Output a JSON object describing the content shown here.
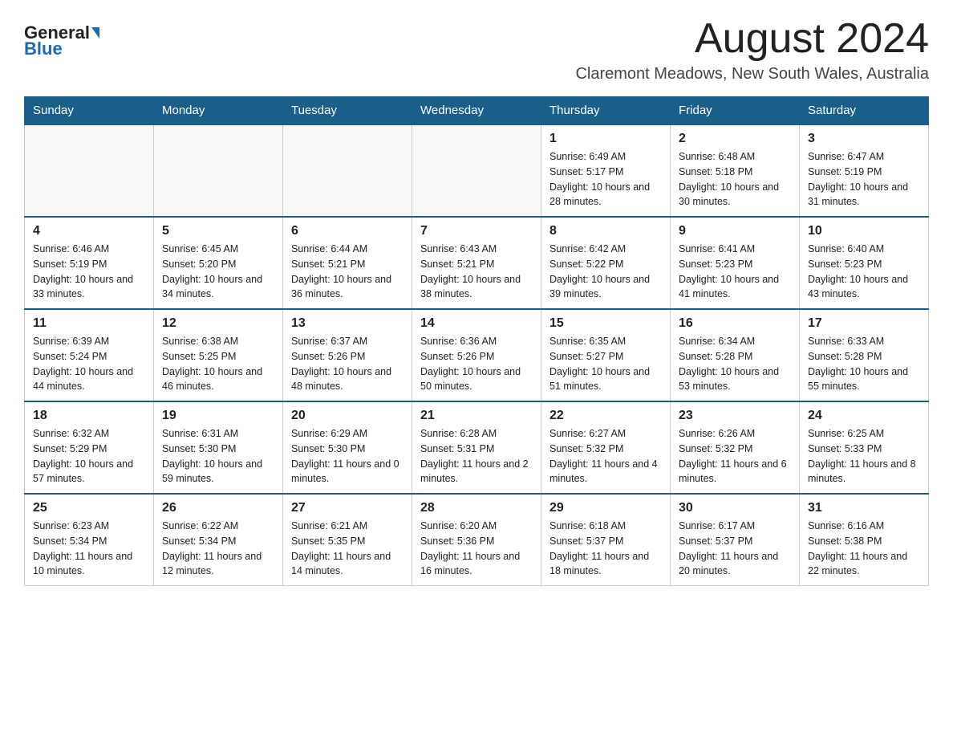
{
  "header": {
    "logo_general": "General",
    "logo_blue": "Blue",
    "month_title": "August 2024",
    "subtitle": "Claremont Meadows, New South Wales, Australia"
  },
  "days_of_week": [
    "Sunday",
    "Monday",
    "Tuesday",
    "Wednesday",
    "Thursday",
    "Friday",
    "Saturday"
  ],
  "weeks": [
    [
      {
        "num": "",
        "info": ""
      },
      {
        "num": "",
        "info": ""
      },
      {
        "num": "",
        "info": ""
      },
      {
        "num": "",
        "info": ""
      },
      {
        "num": "1",
        "info": "Sunrise: 6:49 AM\nSunset: 5:17 PM\nDaylight: 10 hours and 28 minutes."
      },
      {
        "num": "2",
        "info": "Sunrise: 6:48 AM\nSunset: 5:18 PM\nDaylight: 10 hours and 30 minutes."
      },
      {
        "num": "3",
        "info": "Sunrise: 6:47 AM\nSunset: 5:19 PM\nDaylight: 10 hours and 31 minutes."
      }
    ],
    [
      {
        "num": "4",
        "info": "Sunrise: 6:46 AM\nSunset: 5:19 PM\nDaylight: 10 hours and 33 minutes."
      },
      {
        "num": "5",
        "info": "Sunrise: 6:45 AM\nSunset: 5:20 PM\nDaylight: 10 hours and 34 minutes."
      },
      {
        "num": "6",
        "info": "Sunrise: 6:44 AM\nSunset: 5:21 PM\nDaylight: 10 hours and 36 minutes."
      },
      {
        "num": "7",
        "info": "Sunrise: 6:43 AM\nSunset: 5:21 PM\nDaylight: 10 hours and 38 minutes."
      },
      {
        "num": "8",
        "info": "Sunrise: 6:42 AM\nSunset: 5:22 PM\nDaylight: 10 hours and 39 minutes."
      },
      {
        "num": "9",
        "info": "Sunrise: 6:41 AM\nSunset: 5:23 PM\nDaylight: 10 hours and 41 minutes."
      },
      {
        "num": "10",
        "info": "Sunrise: 6:40 AM\nSunset: 5:23 PM\nDaylight: 10 hours and 43 minutes."
      }
    ],
    [
      {
        "num": "11",
        "info": "Sunrise: 6:39 AM\nSunset: 5:24 PM\nDaylight: 10 hours and 44 minutes."
      },
      {
        "num": "12",
        "info": "Sunrise: 6:38 AM\nSunset: 5:25 PM\nDaylight: 10 hours and 46 minutes."
      },
      {
        "num": "13",
        "info": "Sunrise: 6:37 AM\nSunset: 5:26 PM\nDaylight: 10 hours and 48 minutes."
      },
      {
        "num": "14",
        "info": "Sunrise: 6:36 AM\nSunset: 5:26 PM\nDaylight: 10 hours and 50 minutes."
      },
      {
        "num": "15",
        "info": "Sunrise: 6:35 AM\nSunset: 5:27 PM\nDaylight: 10 hours and 51 minutes."
      },
      {
        "num": "16",
        "info": "Sunrise: 6:34 AM\nSunset: 5:28 PM\nDaylight: 10 hours and 53 minutes."
      },
      {
        "num": "17",
        "info": "Sunrise: 6:33 AM\nSunset: 5:28 PM\nDaylight: 10 hours and 55 minutes."
      }
    ],
    [
      {
        "num": "18",
        "info": "Sunrise: 6:32 AM\nSunset: 5:29 PM\nDaylight: 10 hours and 57 minutes."
      },
      {
        "num": "19",
        "info": "Sunrise: 6:31 AM\nSunset: 5:30 PM\nDaylight: 10 hours and 59 minutes."
      },
      {
        "num": "20",
        "info": "Sunrise: 6:29 AM\nSunset: 5:30 PM\nDaylight: 11 hours and 0 minutes."
      },
      {
        "num": "21",
        "info": "Sunrise: 6:28 AM\nSunset: 5:31 PM\nDaylight: 11 hours and 2 minutes."
      },
      {
        "num": "22",
        "info": "Sunrise: 6:27 AM\nSunset: 5:32 PM\nDaylight: 11 hours and 4 minutes."
      },
      {
        "num": "23",
        "info": "Sunrise: 6:26 AM\nSunset: 5:32 PM\nDaylight: 11 hours and 6 minutes."
      },
      {
        "num": "24",
        "info": "Sunrise: 6:25 AM\nSunset: 5:33 PM\nDaylight: 11 hours and 8 minutes."
      }
    ],
    [
      {
        "num": "25",
        "info": "Sunrise: 6:23 AM\nSunset: 5:34 PM\nDaylight: 11 hours and 10 minutes."
      },
      {
        "num": "26",
        "info": "Sunrise: 6:22 AM\nSunset: 5:34 PM\nDaylight: 11 hours and 12 minutes."
      },
      {
        "num": "27",
        "info": "Sunrise: 6:21 AM\nSunset: 5:35 PM\nDaylight: 11 hours and 14 minutes."
      },
      {
        "num": "28",
        "info": "Sunrise: 6:20 AM\nSunset: 5:36 PM\nDaylight: 11 hours and 16 minutes."
      },
      {
        "num": "29",
        "info": "Sunrise: 6:18 AM\nSunset: 5:37 PM\nDaylight: 11 hours and 18 minutes."
      },
      {
        "num": "30",
        "info": "Sunrise: 6:17 AM\nSunset: 5:37 PM\nDaylight: 11 hours and 20 minutes."
      },
      {
        "num": "31",
        "info": "Sunrise: 6:16 AM\nSunset: 5:38 PM\nDaylight: 11 hours and 22 minutes."
      }
    ]
  ]
}
